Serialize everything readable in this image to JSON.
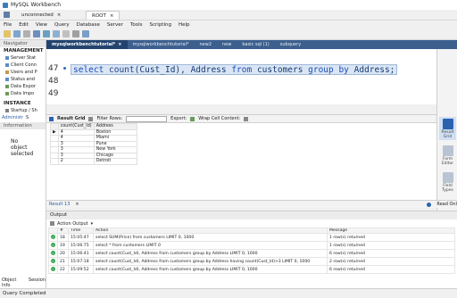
{
  "window": {
    "title": "MySQL Workbench"
  },
  "connection_tabs": [
    {
      "label": "unconnected"
    },
    {
      "label": "ROOT"
    }
  ],
  "menu": [
    "File",
    "Edit",
    "View",
    "Query",
    "Database",
    "Server",
    "Tools",
    "Scripting",
    "Help"
  ],
  "sidebar": {
    "navigator_label": "Navigator",
    "management_title": "MANAGEMENT",
    "management_items": [
      "Server Stat",
      "Client Conn",
      "Users and P",
      "Status and",
      "Data Expor",
      "Data Impo"
    ],
    "instance_title": "INSTANCE",
    "instance_items": [
      "Startup / Sh"
    ],
    "admin_tab": "Administr",
    "schemas_tab": "S",
    "information_label": "Information",
    "no_object": "No object selected",
    "object_info_tab": "Object Info",
    "session_tab": "Session"
  },
  "editor_tabs": [
    "mysqlworkbenchtutorial*",
    "mysqlworkbenchtutorial*",
    "new2",
    "new",
    "basic sql (1)",
    "subquery"
  ],
  "editor": {
    "line_numbers": [
      "47",
      "48",
      "49"
    ],
    "code": {
      "t1": "select ",
      "t2": "count",
      "t3": "(Cust_Id), Address ",
      "t4": "from",
      "t5": " customers ",
      "t6": "group by",
      "t7": " Address;"
    }
  },
  "result_toolbar": {
    "grid_label": "Result Grid",
    "filter_label": "Filter Rows:",
    "export_label": "Export:",
    "wrap_label": "Wrap Cell Content:"
  },
  "result_grid": {
    "columns": [
      "count(Cust_Id)",
      "Address"
    ],
    "rows": [
      [
        "4",
        "Boston"
      ],
      [
        "4",
        "Miami"
      ],
      [
        "3",
        "Pune"
      ],
      [
        "3",
        "New York"
      ],
      [
        "3",
        "Chicago"
      ],
      [
        "2",
        "Detroit"
      ]
    ]
  },
  "right_panel": [
    "Result Grid",
    "Form Editor",
    "Field Types"
  ],
  "result_tabs": {
    "result": "Result 13",
    "read_only": "Read Onl"
  },
  "output": {
    "title": "Output",
    "mode": "Action Output",
    "columns": [
      "#",
      "Time",
      "Action",
      "Message"
    ],
    "rows": [
      [
        "18",
        "15:05:47",
        "select SUM(Price) from customers LIMIT 0, 1000",
        "1 row(s) returned"
      ],
      [
        "19",
        "15:06:75",
        "select * from customers LIMIT 0",
        "1 row(s) returned"
      ],
      [
        "20",
        "15:06:41",
        "select count(Cust_Id), Address from customers group by Address LIMIT 0, 1000",
        "6 row(s) returned"
      ],
      [
        "21",
        "15:07:18",
        "select count(Cust_Id), Address from customers group by Address having count(Cust_Id)>3 LIMIT 0, 1000",
        "2 row(s) returned"
      ],
      [
        "22",
        "15:09:52",
        "select count(Cust_Id), Address from customers group by Address LIMIT 0, 1000",
        "6 row(s) returned"
      ]
    ]
  },
  "status": "Query Completed",
  "colors": {
    "accent": "#3c5f8e",
    "highlight": "#dbe6f5",
    "ok": "#2fa84f"
  }
}
